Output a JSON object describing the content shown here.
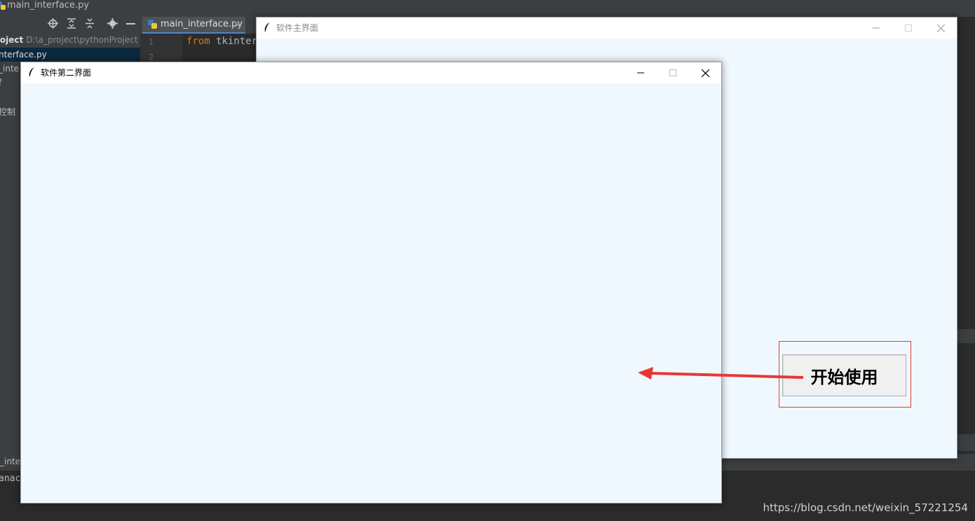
{
  "ide": {
    "title": "main_interface.py",
    "tab_label": "main_interface.py",
    "tab_close_glyph": "×",
    "project_header": "roject",
    "project_path": "D:\\a_project\\pythonProject",
    "project_lines": [
      "nterface.py",
      "_inte",
      "f",
      "控制"
    ],
    "line_numbers": [
      "1",
      "2"
    ],
    "code_keyword": "from",
    "code_rest": " tkinter",
    "bottom_tab": "_inte",
    "console_text": "anac",
    "toolbar_icons": [
      "crosshair-icon",
      "expand-all-icon",
      "collapse-all-icon",
      "gear-icon",
      "minimize-icon"
    ]
  },
  "main_window": {
    "title": "软件主界面",
    "start_button_label": "开始使用",
    "background": "#f0f8ff"
  },
  "second_window": {
    "title": "软件第二界面",
    "background": "#f0f8ff"
  },
  "annotation": {
    "highlight_color": "#e03a3a",
    "arrow_color": "#e53935"
  },
  "watermark": "https://blog.csdn.net/weixin_57221254"
}
